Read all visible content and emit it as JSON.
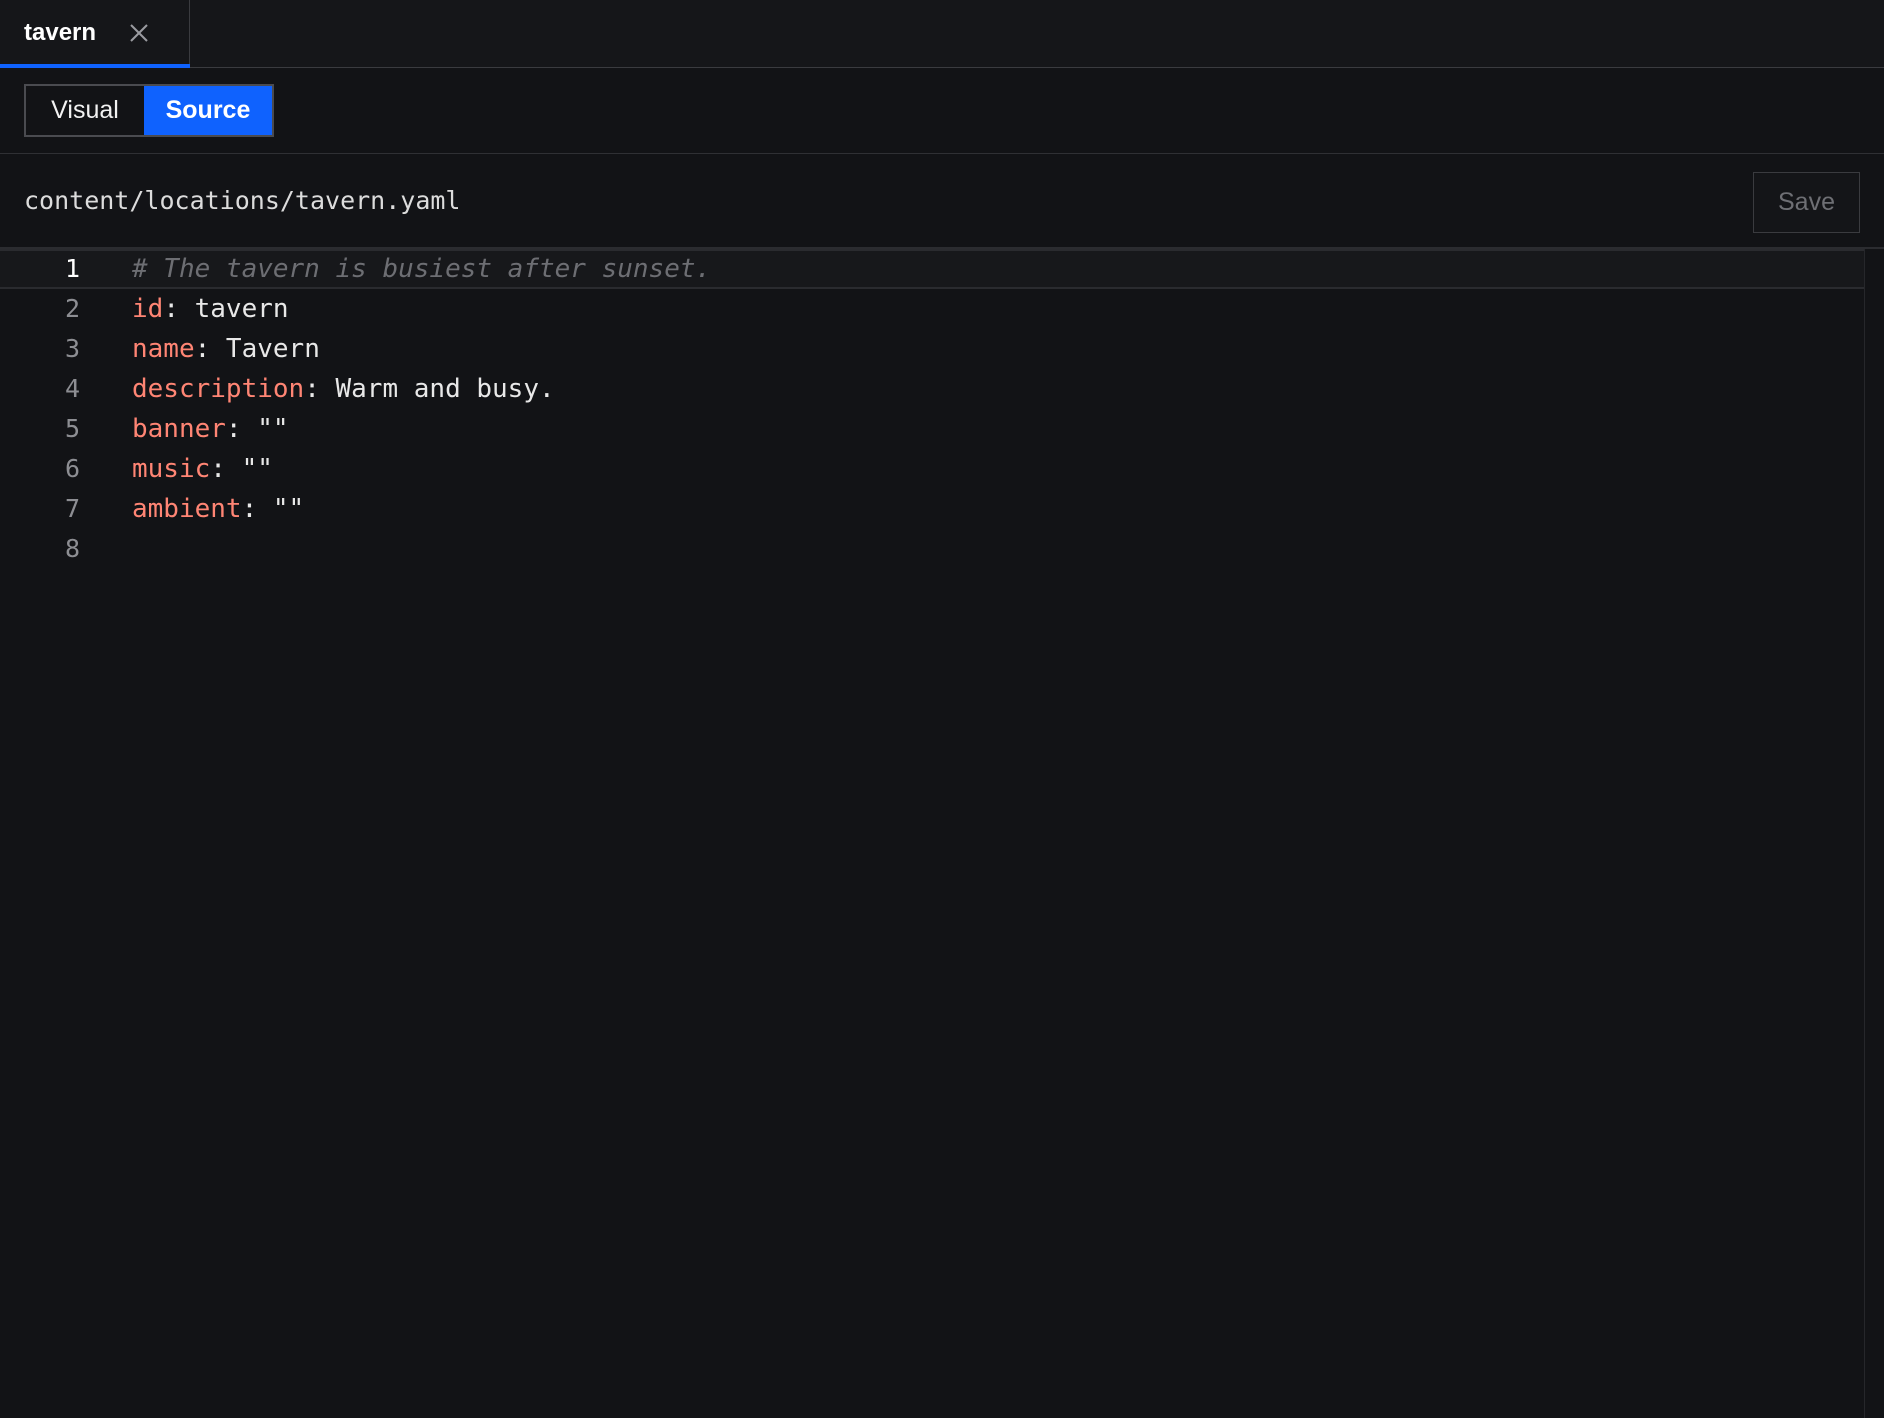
{
  "tab": {
    "label": "tavern",
    "close_icon": "close-icon"
  },
  "mode_toggle": {
    "visual_label": "Visual",
    "source_label": "Source",
    "active": "Source"
  },
  "file": {
    "path": "content/locations/tavern.yaml",
    "save_label": "Save"
  },
  "editor": {
    "lines": [
      {
        "number": "1",
        "comment": "# The tavern is busiest after sunset."
      },
      {
        "number": "2",
        "key": "id",
        "value": " tavern"
      },
      {
        "number": "3",
        "key": "name",
        "value": " Tavern"
      },
      {
        "number": "4",
        "key": "description",
        "value": " Warm and busy."
      },
      {
        "number": "5",
        "key": "banner",
        "value": " \"\""
      },
      {
        "number": "6",
        "key": "music",
        "value": " \"\""
      },
      {
        "number": "7",
        "key": "ambient",
        "value": " \"\""
      },
      {
        "number": "8"
      }
    ]
  },
  "colors": {
    "accent": "#0f62fe",
    "key": "#ff8574",
    "comment": "#6d6e73",
    "background": "#121316"
  }
}
